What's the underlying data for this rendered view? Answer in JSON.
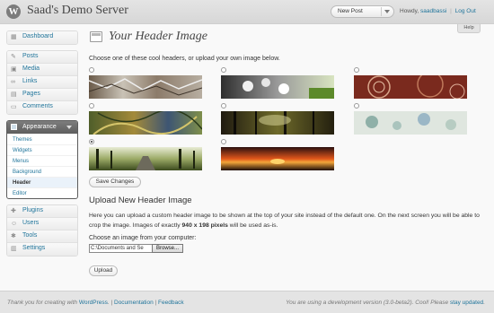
{
  "header": {
    "logo": "W",
    "site_title": "Saad's Demo Server",
    "favorites_label": "New Post",
    "howdy": "Howdy,",
    "username": "saadbassi",
    "separator": "|",
    "logout": "Log Out"
  },
  "help_tab": "Help",
  "sidebar": {
    "dashboard": "Dashboard",
    "posts": "Posts",
    "media": "Media",
    "links": "Links",
    "pages": "Pages",
    "comments": "Comments",
    "appearance": "Appearance",
    "appearance_sub": [
      "Themes",
      "Widgets",
      "Menus",
      "Background",
      "Header",
      "Editor"
    ],
    "plugins": "Plugins",
    "users": "Users",
    "tools": "Tools",
    "settings": "Settings"
  },
  "main": {
    "title": "Your Header Image",
    "intro": "Choose one of these cool headers, or upload your own image below.",
    "headers": [
      "berries",
      "cherryblossom",
      "concave",
      "fern",
      "forestfloor",
      "inkwell",
      "path",
      "sunset"
    ],
    "selected_header": "path",
    "save_button": "Save Changes",
    "upload_title": "Upload New Header Image",
    "upload_desc_1": "Here you can upload a custom header image to be shown at the top of your site instead of the default one. On the next screen you will be able to crop the image. Images of exactly ",
    "upload_desc_bold": "940 x 198 pixels",
    "upload_desc_2": " will be used as-is.",
    "choose_label": "Choose an image from your computer:",
    "file_value": "C:\\Documents and Se",
    "browse_button": "Browse...",
    "upload_button": "Upload"
  },
  "footer": {
    "left_prefix": "Thank you for creating with ",
    "left_wp": "WordPress",
    "left_sep1": ". | ",
    "left_docs": "Documentation",
    "left_sep2": " | ",
    "left_feedback": "Feedback",
    "right_prefix": "You are using a development version (3.0-beta2). Cool! Please ",
    "right_link": "stay updated",
    "right_suffix": "."
  }
}
